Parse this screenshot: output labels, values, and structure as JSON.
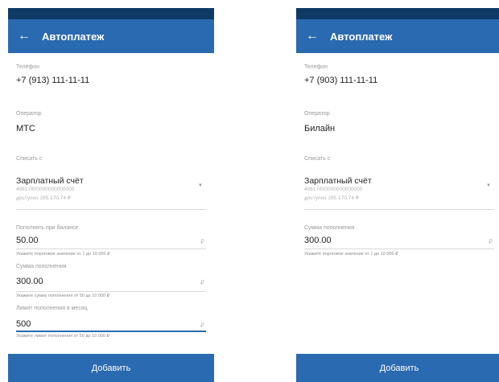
{
  "left": {
    "title": "Автоплатеж",
    "phone_label": "Телефон",
    "phone_value": "+7 (913) 111-11-11",
    "operator_label": "Оператор",
    "operator_value": "МТС",
    "debit_label": "Списать с",
    "account_name": "Зарплатный счёт",
    "account_number": "40817800000000000000",
    "account_available": "доступно 285 170,74 ₽",
    "threshold_label": "Пополнять при балансе",
    "threshold_value": "50.00",
    "threshold_hint": "Укажите пороговое значение от 1 до 10 000 ₽",
    "amount_label": "Сумма пополнения",
    "amount_value": "300.00",
    "amount_hint": "Укажите сумму пополнения от 50 до 10 000 ₽",
    "limit_label": "Лимит пополнения в месяц",
    "limit_value": "500",
    "limit_hint": "Укажите лимит пополнения от 50 до 10 000 ₽",
    "currency": "₽",
    "add_label": "Добавить"
  },
  "right": {
    "title": "Автоплатеж",
    "phone_label": "Телефон",
    "phone_value": "+7 (903) 111-11-11",
    "operator_label": "Оператор",
    "operator_value": "Билайн",
    "debit_label": "Списать с",
    "account_name": "Зарплатный счёт",
    "account_number": "40817800000000000000",
    "account_available": "доступно 285 170,74 ₽",
    "amount_label": "Сумма пополнения",
    "amount_value": "300.00",
    "amount_hint": "Укажите пороговое значение от 1 до 10 000 ₽",
    "currency": "₽",
    "add_label": "Добавить"
  },
  "icons": {
    "back": "arrow-left-icon",
    "dropdown": "caret-down-icon"
  },
  "colors": {
    "primary": "#2a6ab0",
    "status_bar": "#0f3a66",
    "active_underline": "#2a6ab0"
  }
}
